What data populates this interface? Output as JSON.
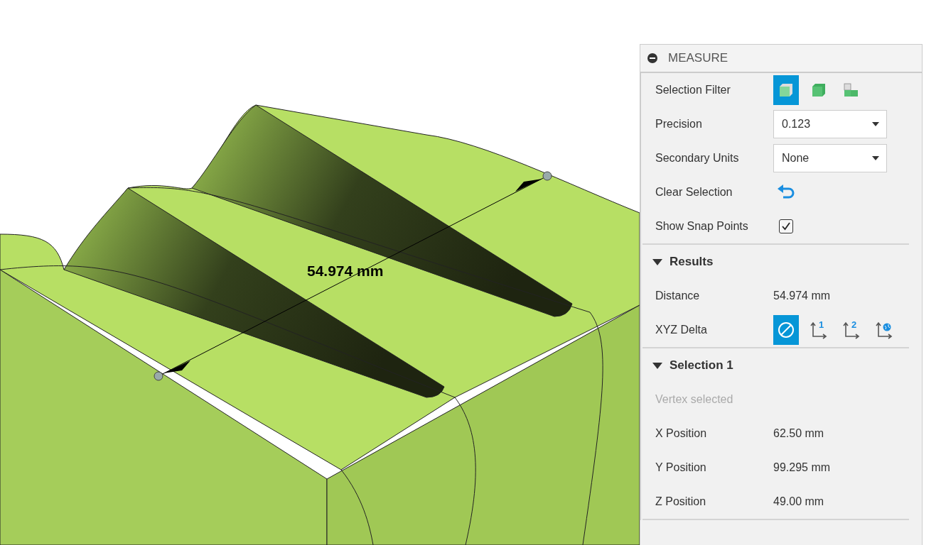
{
  "viewport": {
    "dimension_label": "54.974 mm"
  },
  "panel": {
    "title": "MEASURE",
    "selection_filter": {
      "label": "Selection Filter",
      "options": [
        {
          "kind": "body",
          "selected": true
        },
        {
          "kind": "solid",
          "selected": false
        },
        {
          "kind": "component",
          "selected": false
        }
      ]
    },
    "precision": {
      "label": "Precision",
      "value": "0.123"
    },
    "secondary_units": {
      "label": "Secondary Units",
      "value": "None"
    },
    "clear_selection": {
      "label": "Clear Selection"
    },
    "show_snap_points": {
      "label": "Show Snap Points",
      "checked": true
    },
    "results": {
      "title": "Results",
      "expanded": true,
      "distance": {
        "label": "Distance",
        "value": "54.974 mm"
      },
      "xyz_delta": {
        "label": "XYZ Delta",
        "options": [
          {
            "kind": "none",
            "selected": true
          },
          {
            "kind": "numbered",
            "badge": "1",
            "selected": false
          },
          {
            "kind": "numbered",
            "badge": "2",
            "selected": false
          },
          {
            "kind": "world",
            "selected": false
          }
        ]
      }
    },
    "selection_1": {
      "title": "Selection 1",
      "expanded": true,
      "status": "Vertex selected",
      "rows": [
        {
          "label": "X Position",
          "value": "62.50 mm"
        },
        {
          "label": "Y Position",
          "value": "99.295 mm"
        },
        {
          "label": "Z Position",
          "value": "49.00 mm"
        }
      ]
    }
  }
}
